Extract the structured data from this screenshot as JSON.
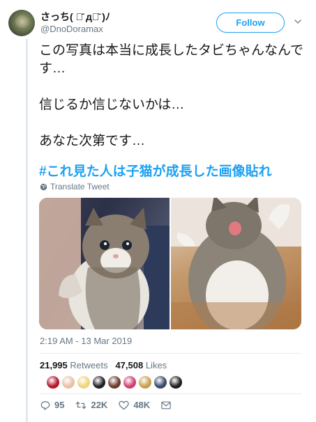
{
  "user": {
    "display_name": "さっち( ･᷄ д･᷅ )ﾉ",
    "handle": "@DnoDoramax"
  },
  "follow_label": "Follow",
  "tweet": {
    "line1": "この写真は本当に成長したタビちゃんなんです…",
    "line2": "信じるか信じないかは…",
    "line3": "あなた次第です…",
    "hashtag": "#これ見た人は子猫が成長した画像貼れ"
  },
  "translate_label": "Translate Tweet",
  "media": [
    {
      "name": "kitten-photo"
    },
    {
      "name": "grown-cat-photo"
    }
  ],
  "timestamp": "2:19 AM - 13 Mar 2019",
  "stats": {
    "retweets_count": "21,995",
    "retweets_label": "Retweets",
    "likes_count": "47,508",
    "likes_label": "Likes"
  },
  "liker_colors": [
    "#b5172b",
    "#e8c0a8",
    "#f2d27a",
    "#222222",
    "#6b3b2a",
    "#d04070",
    "#c8a04a",
    "#3b4a6b",
    "#1e1e1e"
  ],
  "actions": {
    "replies": "95",
    "retweets": "22K",
    "likes": "48K"
  }
}
